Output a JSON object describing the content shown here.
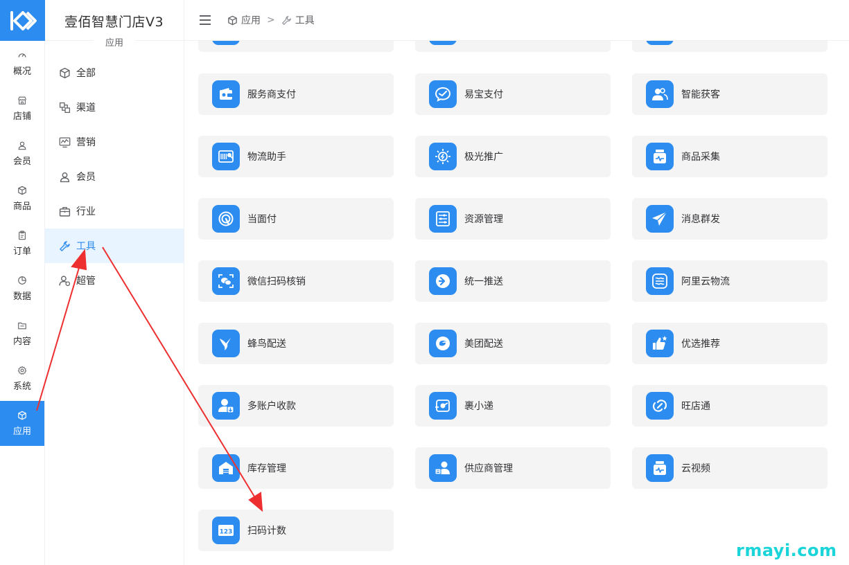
{
  "brand": {
    "title": "壹佰智慧门店V3",
    "section": "应用"
  },
  "rail": [
    {
      "label": "概况",
      "icon": "dashboard-icon"
    },
    {
      "label": "店铺",
      "icon": "store-icon"
    },
    {
      "label": "会员",
      "icon": "user-icon"
    },
    {
      "label": "商品",
      "icon": "box-icon"
    },
    {
      "label": "订单",
      "icon": "clipboard-icon"
    },
    {
      "label": "数据",
      "icon": "pie-icon"
    },
    {
      "label": "内容",
      "icon": "folder-icon"
    },
    {
      "label": "系统",
      "icon": "gear-icon"
    },
    {
      "label": "应用",
      "icon": "cube-icon",
      "active": true
    }
  ],
  "submenu": [
    {
      "label": "全部",
      "icon": "cube-icon"
    },
    {
      "label": "渠道",
      "icon": "channel-icon"
    },
    {
      "label": "营销",
      "icon": "monitor-chart-icon"
    },
    {
      "label": "会员",
      "icon": "user-icon"
    },
    {
      "label": "行业",
      "icon": "briefcase-icon"
    },
    {
      "label": "工具",
      "icon": "wrench-icon",
      "active": true
    },
    {
      "label": "超管",
      "icon": "admin-user-icon"
    }
  ],
  "breadcrumb": {
    "root": "应用",
    "separator": ">",
    "current": "工具"
  },
  "apps": [
    {
      "label": "服务商支付",
      "icon": "wallet-icon"
    },
    {
      "label": "易宝支付",
      "icon": "chat-bubble-icon"
    },
    {
      "label": "智能获客",
      "icon": "people-icon"
    },
    {
      "label": "物流助手",
      "icon": "barcode-search-icon"
    },
    {
      "label": "极光推广",
      "icon": "sun-bolt-icon"
    },
    {
      "label": "商品采集",
      "icon": "jar-pulse-icon"
    },
    {
      "label": "当面付",
      "icon": "target-touch-icon"
    },
    {
      "label": "资源管理",
      "icon": "sliders-icon"
    },
    {
      "label": "消息群发",
      "icon": "paper-plane-icon"
    },
    {
      "label": "微信扫码核销",
      "icon": "wechat-scan-icon"
    },
    {
      "label": "统一推送",
      "icon": "arrow-bubble-icon"
    },
    {
      "label": "阿里云物流",
      "icon": "cloud-logistics-icon"
    },
    {
      "label": "蜂鸟配送",
      "icon": "hummingbird-icon"
    },
    {
      "label": "美团配送",
      "icon": "meituan-icon"
    },
    {
      "label": "优选推荐",
      "icon": "thumbs-up-icon"
    },
    {
      "label": "多账户收款",
      "icon": "account-download-icon"
    },
    {
      "label": "裹小递",
      "icon": "delivery-icon"
    },
    {
      "label": "旺店通",
      "icon": "link-icon"
    },
    {
      "label": "库存管理",
      "icon": "warehouse-icon"
    },
    {
      "label": "供应商管理",
      "icon": "supplier-icon"
    },
    {
      "label": "云视频",
      "icon": "jar-pulse-icon"
    },
    {
      "label": "扫码计数",
      "icon": "number-123-icon"
    }
  ],
  "watermark": "rmayi.com",
  "colors": {
    "accent": "#2d8cf0",
    "active_bg": "#e8f4ff",
    "card_bg": "#f4f4f5",
    "annotation": "#ee2f2f"
  }
}
